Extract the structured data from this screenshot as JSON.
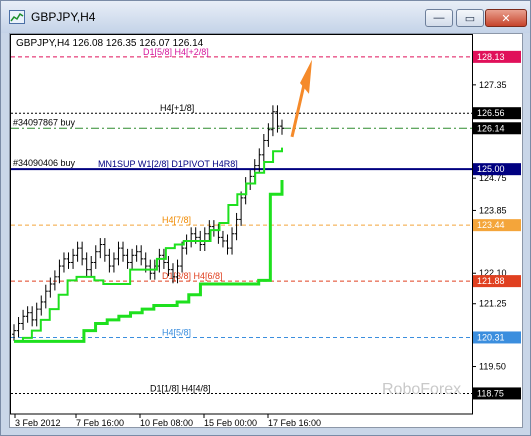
{
  "window": {
    "title": "GBPJPY,H4",
    "minimize_label": "—",
    "maximize_label": "▭",
    "close_label": "✕"
  },
  "header": {
    "symbol_line": "GBPJPY,H4  126.08 126.35 126.07 126.14"
  },
  "watermark": "RoboForex",
  "levels": [
    {
      "label": "D1[5/8] H4[+2/8]",
      "price": "128.13",
      "color": "#e0105a",
      "label_color": "#d4149b",
      "style": "dash"
    },
    {
      "label": "H4[+1/8]",
      "price": "126.56",
      "color": "#000000",
      "label_color": "#000000",
      "style": "dot"
    },
    {
      "label": "",
      "price": "126.14",
      "color": "#000000",
      "label_color": "#000000",
      "style": "dashgreen"
    },
    {
      "label": "MN1SUP W1[2/8] D1PIVOT H4R8]",
      "price": "125.00",
      "color": "#000080",
      "label_color": "#000080",
      "style": "solid"
    },
    {
      "label": "H4[7/8]",
      "price": "123.44",
      "color": "#f4a53a",
      "label_color": "#f08a00",
      "style": "dash"
    },
    {
      "label": "D1[3/8] H4[6/8]",
      "price": "121.88",
      "color": "#e04020",
      "label_color": "#e04020",
      "style": "dash"
    },
    {
      "label": "H4[5/8]",
      "price": "120.31",
      "color": "#3b8ede",
      "label_color": "#3b8ede",
      "style": "dash"
    },
    {
      "label": "D1[1/8] H4[4/8]",
      "price": "118.75",
      "color": "#000000",
      "label_color": "#000000",
      "style": "dot"
    }
  ],
  "orders": [
    {
      "label": "#34097867 buy"
    },
    {
      "label": "#34090406 buy"
    }
  ],
  "y_ticks": [
    "127.35",
    "124.75",
    "123.85",
    "122.10",
    "121.25",
    "119.50"
  ],
  "x_ticks": [
    "3 Feb 2012",
    "7 Feb 16:00",
    "10 Feb 08:00",
    "15 Feb 00:00",
    "17 Feb 16:00"
  ],
  "chart_data": {
    "type": "bar",
    "symbol": "GBPJPY",
    "timeframe": "H4",
    "ohlc_current": {
      "open": 126.08,
      "high": 126.35,
      "low": 126.07,
      "close": 126.14
    },
    "ylim": [
      118.4,
      128.6
    ],
    "closes": [
      120.5,
      120.7,
      120.9,
      121.0,
      120.8,
      121.1,
      121.3,
      121.6,
      121.8,
      122.0,
      122.3,
      122.5,
      122.4,
      122.6,
      122.8,
      122.5,
      122.2,
      122.4,
      122.7,
      122.9,
      122.6,
      122.3,
      122.5,
      122.8,
      122.6,
      122.4,
      122.6,
      122.7,
      122.5,
      122.3,
      122.1,
      122.3,
      122.6,
      122.4,
      122.2,
      122.0,
      122.3,
      122.8,
      123.0,
      123.2,
      123.1,
      122.9,
      123.2,
      123.4,
      123.3,
      123.1,
      123.0,
      122.8,
      123.2,
      123.6,
      124.2,
      124.6,
      124.8,
      125.1,
      125.4,
      125.8,
      126.1,
      126.6,
      126.2,
      126.14
    ],
    "support_green": [
      120.2,
      120.3,
      120.5,
      120.8,
      121.1,
      121.5,
      121.9,
      122.0,
      122.0,
      121.9,
      121.8,
      121.8,
      121.8,
      122.2,
      122.2,
      122.2,
      122.5,
      122.8,
      122.9,
      123.0,
      123.0,
      123.0,
      123.3,
      123.5,
      124.0,
      124.3,
      124.6,
      124.9,
      125.2,
      125.5,
      125.6
    ],
    "support_green_slow": [
      120.2,
      120.2,
      120.2,
      120.2,
      120.2,
      120.2,
      120.5,
      120.7,
      120.8,
      120.9,
      121.0,
      121.1,
      121.2,
      121.2,
      121.3,
      121.5,
      121.8,
      121.8,
      121.8,
      121.8,
      121.8,
      121.9,
      124.3,
      124.7
    ]
  }
}
